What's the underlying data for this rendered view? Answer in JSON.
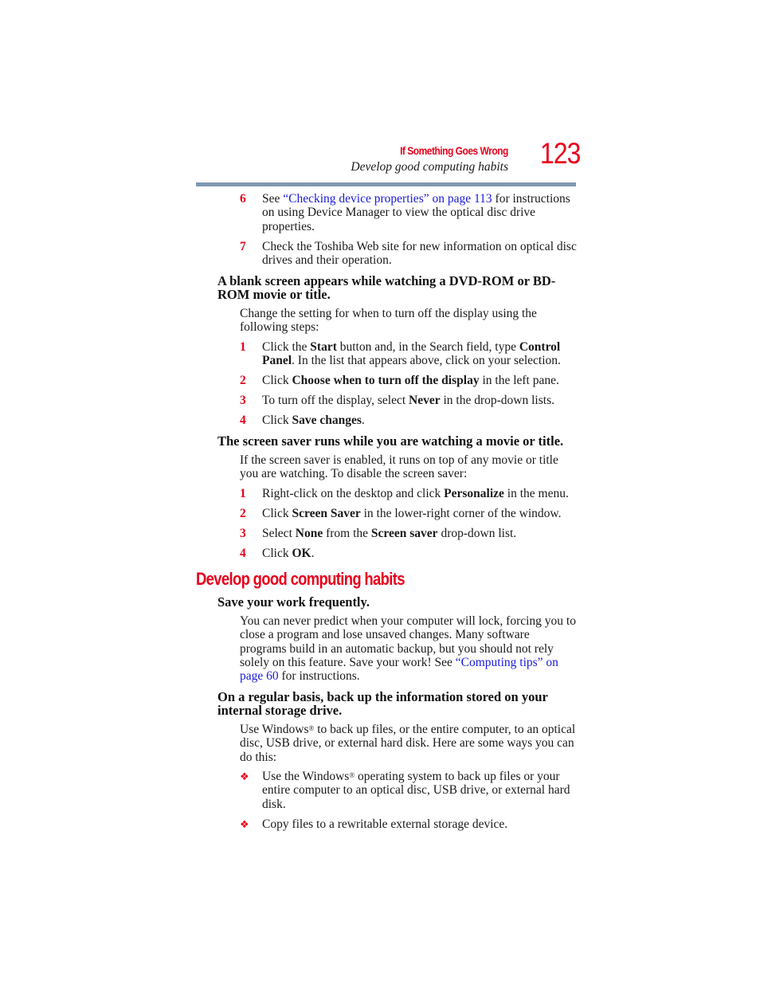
{
  "header": {
    "chapter": "If Something Goes Wrong",
    "section": "Develop good computing habits",
    "page_number": "123"
  },
  "colors": {
    "accent_red": "#e8001c",
    "link_blue": "#1a1adb",
    "rule_gray_blue": "#7f98b0"
  },
  "optical_steps": [
    {
      "num": "6",
      "pre": "See ",
      "link": "“Checking device properties” on page 113",
      "post": " for instructions on using Device Manager to view the optical disc drive properties."
    },
    {
      "num": "7",
      "text": "Check the Toshiba Web site for new information on optical disc drives and their operation."
    }
  ],
  "blank_screen": {
    "heading": "A blank screen appears while watching a DVD-ROM or BD-ROM movie or title.",
    "intro": "Change the setting for when to turn off the display using the following steps:",
    "steps": [
      {
        "num": "1",
        "t1": "Click the ",
        "b1": "Start",
        "t2": " button and, in the Search field, type ",
        "b2": "Control Panel",
        "t3": ". In the list that appears above, click on your selection."
      },
      {
        "num": "2",
        "t1": "Click ",
        "b1": "Choose when to turn off the display",
        "t2": " in the left pane."
      },
      {
        "num": "3",
        "t1": "To turn off the display, select ",
        "b1": "Never",
        "t2": " in the drop-down lists."
      },
      {
        "num": "4",
        "t1": "Click ",
        "b1": "Save changes",
        "t2": "."
      }
    ]
  },
  "screen_saver": {
    "heading": "The screen saver runs while you are watching a movie or title.",
    "intro": "If the screen saver is enabled, it runs on top of any movie or title you are watching. To disable the screen saver:",
    "steps": [
      {
        "num": "1",
        "t1": "Right-click on the desktop and click ",
        "b1": "Personalize",
        "t2": " in the menu."
      },
      {
        "num": "2",
        "t1": "Click ",
        "b1": "Screen Saver",
        "t2": " in the lower-right corner of the window."
      },
      {
        "num": "3",
        "t1": "Select ",
        "b1": "None",
        "t2": " from the ",
        "b2": "Screen saver",
        "t3": " drop-down list."
      },
      {
        "num": "4",
        "t1": "Click ",
        "b1": "OK",
        "t2": "."
      }
    ]
  },
  "habits": {
    "title": "Develop good computing habits",
    "save_work": {
      "heading": "Save your work frequently.",
      "body_pre": "You can never predict when your computer will lock, forcing you to close a program and lose unsaved changes. Many software programs build in an automatic backup, but you should not rely solely on this feature. Save your work! See ",
      "link": "“Computing tips” on page 60",
      "body_post": " for instructions."
    },
    "backup": {
      "heading": "On a regular basis, back up the information stored on your internal storage drive.",
      "intro_pre": "Use Windows",
      "registered": "®",
      "intro_post": " to back up files, or the entire computer, to an optical disc, USB drive, or external hard disk. Here are some ways you can do this:",
      "bullet_glyph": "❖",
      "bullets": [
        {
          "pre": "Use the Windows",
          "sup": "®",
          "post": " operating system to back up files or your entire computer to an optical disc, USB drive, or external hard disk."
        },
        {
          "text": "Copy files to a rewritable external storage device."
        }
      ]
    }
  }
}
